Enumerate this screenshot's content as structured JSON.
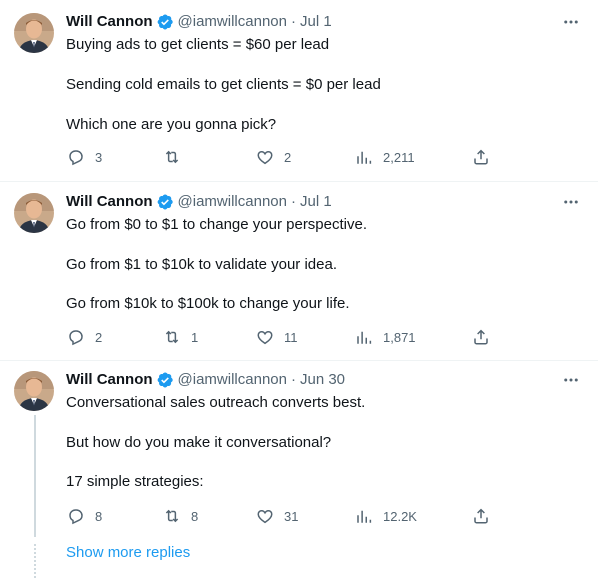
{
  "tweets": [
    {
      "name": "Will Cannon",
      "handle": "@iamwillcannon",
      "sep": "·",
      "date": "Jul 1",
      "lines": [
        "Buying ads to get clients = $60 per lead",
        "Sending cold emails to get clients = $0 per lead",
        "Which one are you gonna pick?"
      ],
      "replies": "3",
      "retweets": "",
      "likes": "2",
      "views": "2,211"
    },
    {
      "name": "Will Cannon",
      "handle": "@iamwillcannon",
      "sep": "·",
      "date": "Jul 1",
      "lines": [
        "Go from $0 to $1 to change your perspective.",
        "Go from $1 to $10k to validate your idea.",
        "Go from $10k to $100k to change your life."
      ],
      "replies": "2",
      "retweets": "1",
      "likes": "11",
      "views": "1,871"
    },
    {
      "name": "Will Cannon",
      "handle": "@iamwillcannon",
      "sep": "·",
      "date": "Jun 30",
      "lines": [
        "Conversational sales outreach converts best.",
        "But how do you make it conversational?",
        "17 simple strategies:"
      ],
      "replies": "8",
      "retweets": "8",
      "likes": "31",
      "views": "12.2K"
    }
  ],
  "show_more_replies": "Show more replies",
  "icons": {
    "reply": "reply-icon",
    "retweet": "retweet-icon",
    "like": "heart-icon",
    "views": "views-icon",
    "share": "share-icon",
    "more": "more-icon",
    "verified": "verified-badge-icon"
  },
  "colors": {
    "text": "#0f1419",
    "secondary": "#536471",
    "accent": "#1d9bf0",
    "divider": "#eff3f4"
  }
}
